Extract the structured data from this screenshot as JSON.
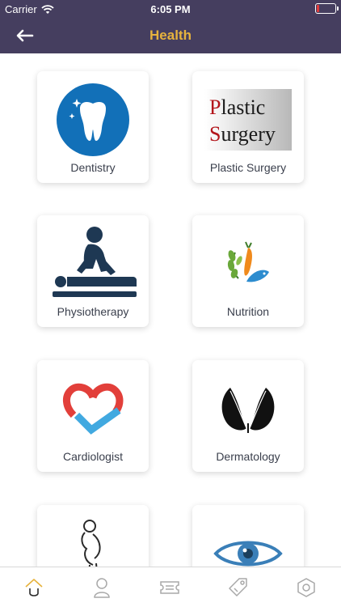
{
  "status_bar": {
    "carrier": "Carrier",
    "time": "6:05 PM",
    "battery_level": 0.12,
    "battery_color": "#e03a3a"
  },
  "nav": {
    "title": "Health",
    "back_icon": "back-arrow-icon",
    "background": "#453e5f",
    "title_color": "#e7b33d"
  },
  "categories": [
    {
      "label": "Dentistry",
      "icon": "tooth-icon",
      "color": "#1270b8"
    },
    {
      "label": "Plastic Surgery",
      "icon": "plastic-surgery-logo",
      "logo_text": [
        "Plastic",
        "Surgery"
      ]
    },
    {
      "label": "Physiotherapy",
      "icon": "physiotherapy-icon",
      "color": "#1e3853"
    },
    {
      "label": "Nutrition",
      "icon": "nutrition-icon"
    },
    {
      "label": "Cardiologist",
      "icon": "heart-check-icon"
    },
    {
      "label": "Dermatology",
      "icon": "feather-icon"
    },
    {
      "label": "",
      "icon": "pregnancy-icon"
    },
    {
      "label": "",
      "icon": "eye-icon"
    }
  ],
  "tab_bar": {
    "tabs": [
      {
        "icon": "home-icon",
        "active": true
      },
      {
        "icon": "profile-icon",
        "active": false
      },
      {
        "icon": "ticket-icon",
        "active": false
      },
      {
        "icon": "tag-icon",
        "active": false
      },
      {
        "icon": "settings-hexagon-icon",
        "active": false
      }
    ],
    "active_color": "#e7b33d",
    "inactive_color": "#a8a8a8"
  }
}
